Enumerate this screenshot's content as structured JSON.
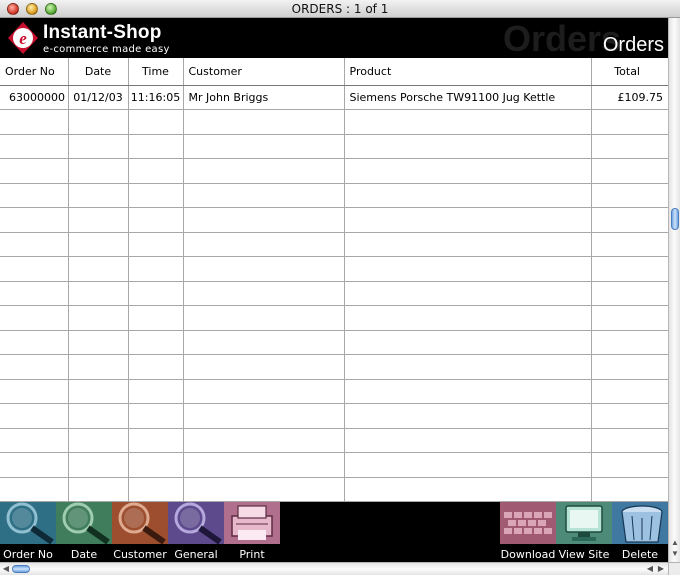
{
  "window": {
    "title": "ORDERS : 1 of 1"
  },
  "header": {
    "brand": "Instant-Shop",
    "tagline": "e-commerce made easy",
    "watermark": "Orders",
    "section_title": "Orders"
  },
  "table": {
    "columns": [
      "Order No",
      "Date",
      "Time",
      "Customer",
      "Product",
      "Total"
    ],
    "rows": [
      {
        "order_no": "63000000",
        "date": "01/12/03",
        "time": "11:16:05",
        "customer": "Mr John Briggs",
        "product": "Siemens Porsche TW91100 Jug Kettle",
        "total": "£109.75"
      }
    ]
  },
  "toolbar": {
    "left": [
      {
        "label": "Order No",
        "icon": "magnifier-icon"
      },
      {
        "label": "Date",
        "icon": "magnifier-icon"
      },
      {
        "label": "Customer",
        "icon": "magnifier-icon"
      },
      {
        "label": "General",
        "icon": "magnifier-icon"
      },
      {
        "label": "Print",
        "icon": "printer-icon"
      }
    ],
    "right": [
      {
        "label": "Download",
        "icon": "keyboard-icon"
      },
      {
        "label": "View Site",
        "icon": "monitor-icon"
      },
      {
        "label": "Delete",
        "icon": "trash-icon"
      }
    ]
  },
  "colors": {
    "header_bg": "#000000",
    "logo_red": "#c8102e",
    "btn_orderno": "#2e6f86",
    "btn_date": "#3f7d5c",
    "btn_customer": "#9c4e2f",
    "btn_general": "#5c4a8c",
    "btn_print": "#b06f8c",
    "btn_download": "#a05a72",
    "btn_viewsite": "#4e8a78",
    "btn_delete": "#3f78a0"
  }
}
